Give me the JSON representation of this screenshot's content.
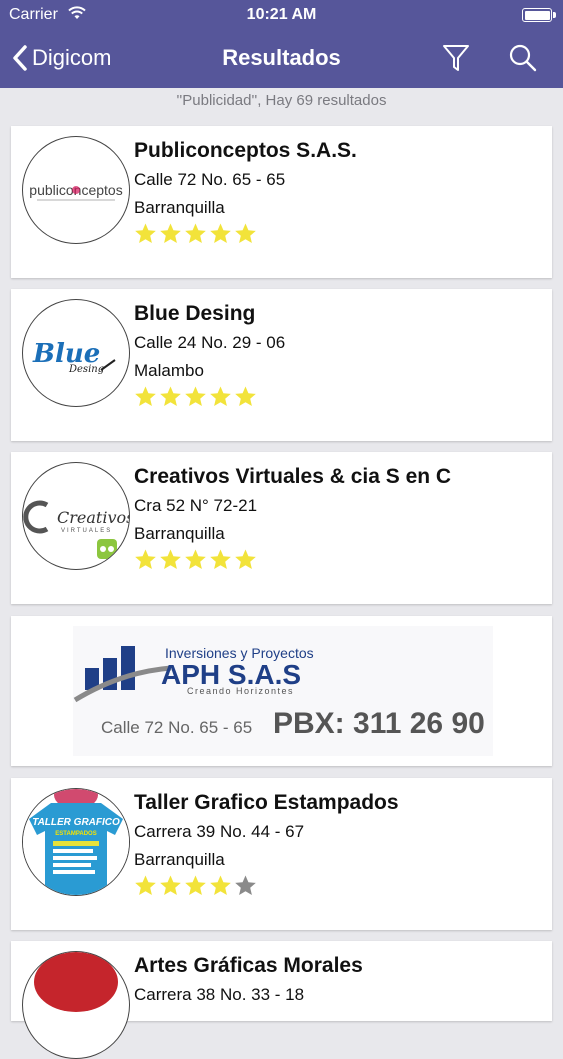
{
  "status_bar": {
    "carrier": "Carrier",
    "time": "10:21 AM"
  },
  "nav": {
    "back_label": "Digicom",
    "title": "Resultados"
  },
  "summary": "''Publicidad'', Hay 69 resultados",
  "results": [
    {
      "name": "Publiconceptos S.A.S.",
      "address": "Calle 72 No. 65 - 65",
      "city": "Barranquilla",
      "rating": 5,
      "logo_text": "publiconceptos"
    },
    {
      "name": "Blue Desing",
      "address": "Calle 24 No. 29 - 06",
      "city": "Malambo",
      "rating": 5,
      "logo_text": "Blue",
      "logo_subtext": "Desing"
    },
    {
      "name": "Creativos Virtuales & cia S en C",
      "address": "Cra 52 N° 72-21",
      "city": "Barranquilla",
      "rating": 5,
      "logo_text": "Creativos",
      "logo_subtext": "VIRTUALES"
    },
    {
      "name": "Taller Grafico Estampados",
      "address": "Carrera 39 No. 44 - 67",
      "city": "Barranquilla",
      "rating": 4,
      "logo_text": "TALLER GRAFICO",
      "logo_subtext": "ESTAMPADOS"
    },
    {
      "name": "Artes Gráficas Morales",
      "address": "Carrera 38 No. 33 - 18",
      "city": "",
      "rating": 0
    }
  ],
  "banner": {
    "tagline": "Inversiones y Proyectos",
    "company": "APH S.A.S",
    "slogan": "Creando Horizontes",
    "address": "Calle 72 No. 65 - 65",
    "phone": "PBX: 311 26 90"
  },
  "colors": {
    "nav_bg": "#56569a",
    "star_on": "#f2e33a",
    "star_off": "#8a8a8a",
    "banner_blue": "#1f3f87"
  }
}
